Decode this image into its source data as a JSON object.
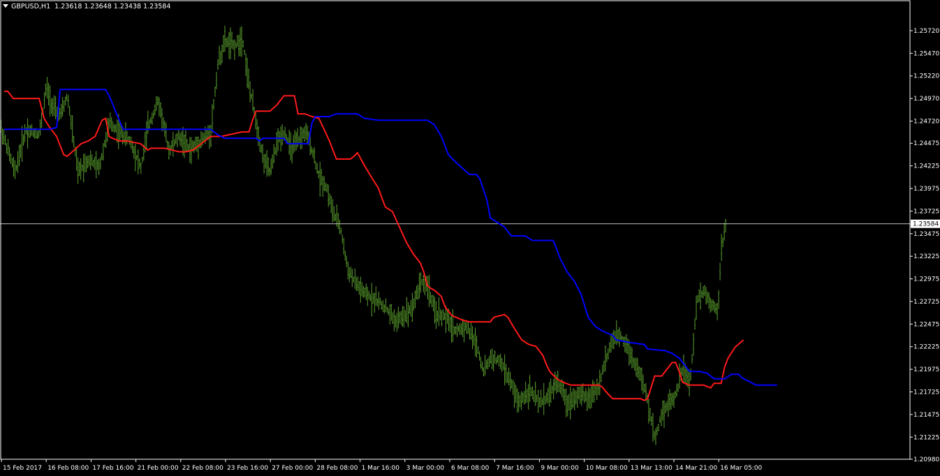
{
  "header": {
    "symbol": "GBPUSD,H1",
    "quote": "1.23618 1.23648 1.23438 1.23584"
  },
  "colors": {
    "background": "#000000",
    "candles": "#5aa02c",
    "line_red": "#ff1a1a",
    "line_blue": "#0000ff",
    "axis": "#ffffff",
    "price_line": "#c0c0c0"
  },
  "chart_data": {
    "type": "line",
    "title": "GBPUSD,H1",
    "ylim": [
      1.2098,
      1.2582
    ],
    "current_price": "1.23584",
    "y_ticks": [
      "1.25720",
      "1.25470",
      "1.25220",
      "1.24970",
      "1.24720",
      "1.24475",
      "1.24225",
      "1.23975",
      "1.23725",
      "1.23475",
      "1.23225",
      "1.22975",
      "1.22725",
      "1.22475",
      "1.22225",
      "1.21975",
      "1.21725",
      "1.21475",
      "1.21225",
      "1.20980"
    ],
    "x_ticks": [
      "15 Feb 2017",
      "16 Feb 08:00",
      "17 Feb 16:00",
      "21 Feb 00:00",
      "22 Feb 08:00",
      "23 Feb 16:00",
      "27 Feb 00:00",
      "28 Feb 08:00",
      "1 Mar 16:00",
      "3 Mar 00:00",
      "6 Mar 08:00",
      "7 Mar 16:00",
      "9 Mar 00:00",
      "10 Mar 08:00",
      "13 Mar 13:00",
      "14 Mar 21:00",
      "16 Mar 05:00"
    ],
    "x_range": [
      0,
      1300
    ],
    "price_series": {
      "name": "",
      "x": [
        0,
        20,
        35,
        55,
        65,
        75,
        85,
        95,
        110,
        125,
        140,
        155,
        170,
        185,
        200,
        210,
        225,
        240,
        255,
        270,
        285,
        300,
        310,
        320,
        335,
        345,
        355,
        365,
        375,
        385,
        395,
        405,
        415,
        425,
        435,
        445,
        455,
        465,
        475,
        485,
        495,
        505,
        520,
        535,
        550,
        565,
        580,
        590,
        600,
        610,
        620,
        635,
        650,
        665,
        680,
        690,
        700,
        715,
        730,
        740,
        755,
        770,
        785,
        795,
        810,
        825,
        840,
        855,
        865,
        875,
        885,
        895,
        905,
        915,
        925,
        935,
        945,
        955,
        965,
        975,
        985,
        995,
        1005,
        1015,
        1025,
        1030,
        1037
      ],
      "y": [
        1.2464,
        1.2415,
        1.2462,
        1.2458,
        1.251,
        1.2485,
        1.2478,
        1.25,
        1.2415,
        1.243,
        1.242,
        1.247,
        1.246,
        1.245,
        1.242,
        1.2465,
        1.2495,
        1.244,
        1.2455,
        1.244,
        1.245,
        1.246,
        1.2535,
        1.256,
        1.2555,
        1.2565,
        1.251,
        1.247,
        1.243,
        1.2415,
        1.245,
        1.246,
        1.244,
        1.245,
        1.246,
        1.244,
        1.241,
        1.24,
        1.237,
        1.2355,
        1.231,
        1.2295,
        1.228,
        1.2275,
        1.2265,
        1.225,
        1.226,
        1.227,
        1.2295,
        1.229,
        1.226,
        1.2255,
        1.224,
        1.2245,
        1.2225,
        1.2195,
        1.221,
        1.2205,
        1.218,
        1.216,
        1.2175,
        1.216,
        1.217,
        1.2185,
        1.216,
        1.217,
        1.2165,
        1.218,
        1.221,
        1.223,
        1.2235,
        1.2225,
        1.2205,
        1.219,
        1.216,
        1.212,
        1.215,
        1.216,
        1.217,
        1.22,
        1.218,
        1.2275,
        1.2285,
        1.227,
        1.2265,
        1.233,
        1.236
      ]
    },
    "series": [
      {
        "name": "",
        "color": "#ff1a1a",
        "x": [
          5,
          10,
          18,
          55,
          62,
          70,
          80,
          90,
          95,
          105,
          115,
          125,
          135,
          145,
          150,
          155,
          160,
          170,
          180,
          200,
          210,
          215,
          225,
          235,
          255,
          265,
          275,
          300,
          315,
          345,
          355,
          360,
          365,
          375,
          385,
          395,
          405,
          410,
          420,
          425,
          435,
          445,
          455,
          470,
          480,
          500,
          505,
          510,
          520,
          530,
          540,
          545,
          550,
          560,
          570,
          580,
          590,
          600,
          605,
          610,
          615,
          620,
          630,
          635,
          645,
          660,
          670,
          680,
          690,
          700,
          705,
          720,
          725,
          735,
          745,
          755,
          765,
          775,
          780,
          785,
          795,
          805,
          815,
          825,
          840,
          850,
          855,
          860,
          865,
          875,
          885,
          905,
          915,
          920,
          925,
          935,
          945,
          955,
          960,
          965,
          970,
          975,
          985,
          1005,
          1015,
          1020,
          1030,
          1035,
          1040,
          1050,
          1062
        ],
        "y": [
          1.2505,
          1.2505,
          1.2497,
          1.2497,
          1.2475,
          1.2465,
          1.2455,
          1.2435,
          1.2433,
          1.244,
          1.2447,
          1.245,
          1.2455,
          1.2473,
          1.2475,
          1.2455,
          1.2453,
          1.245,
          1.245,
          1.2447,
          1.244,
          1.2442,
          1.2442,
          1.2442,
          1.2438,
          1.2438,
          1.244,
          1.2455,
          1.2455,
          1.246,
          1.246,
          1.2473,
          1.2483,
          1.2483,
          1.2483,
          1.249,
          1.25,
          1.25,
          1.25,
          1.248,
          1.248,
          1.2477,
          1.2475,
          1.245,
          1.243,
          1.243,
          1.2433,
          1.2437,
          1.2423,
          1.241,
          1.2398,
          1.2387,
          1.2377,
          1.2372,
          1.2355,
          1.2338,
          1.2325,
          1.2315,
          1.2305,
          1.229,
          1.2287,
          1.2285,
          1.2278,
          1.2267,
          1.2257,
          1.2252,
          1.225,
          1.225,
          1.225,
          1.225,
          1.2255,
          1.2258,
          1.2255,
          1.2242,
          1.223,
          1.2225,
          1.2223,
          1.2213,
          1.2203,
          1.2195,
          1.2187,
          1.2183,
          1.218,
          1.218,
          1.218,
          1.218,
          1.218,
          1.2178,
          1.2173,
          1.2165,
          1.2165,
          1.2165,
          1.2165,
          1.2163,
          1.2165,
          1.219,
          1.219,
          1.22,
          1.2205,
          1.2205,
          1.2195,
          1.2183,
          1.218,
          1.218,
          1.2177,
          1.2182,
          1.2182,
          1.22,
          1.221,
          1.2222,
          1.223
        ]
      },
      {
        "name": "",
        "color": "#0000ff",
        "x": [
          5,
          70,
          80,
          85,
          150,
          155,
          175,
          190,
          200,
          300,
          310,
          320,
          350,
          365,
          370,
          375,
          405,
          410,
          440,
          445,
          450,
          470,
          480,
          510,
          520,
          540,
          610,
          620,
          630,
          640,
          650,
          660,
          670,
          680,
          685,
          695,
          700,
          710,
          720,
          730,
          750,
          760,
          790,
          800,
          810,
          820,
          830,
          840,
          850,
          860,
          875,
          880,
          900,
          920,
          925,
          950,
          960,
          970,
          975,
          985,
          1000,
          1010,
          1015,
          1020,
          1025,
          1035,
          1045,
          1055,
          1060,
          1080,
          1110
        ],
        "y": [
          1.2463,
          1.2463,
          1.2465,
          1.2507,
          1.2507,
          1.25,
          1.2463,
          1.2463,
          1.2463,
          1.2463,
          1.2457,
          1.2453,
          1.2453,
          1.2453,
          1.245,
          1.2453,
          1.2453,
          1.2447,
          1.2447,
          1.247,
          1.2477,
          1.2477,
          1.248,
          1.248,
          1.2475,
          1.2473,
          1.2473,
          1.2468,
          1.2455,
          1.2435,
          1.2427,
          1.242,
          1.2413,
          1.2413,
          1.2408,
          1.2385,
          1.2365,
          1.236,
          1.2355,
          1.2345,
          1.2345,
          1.234,
          1.234,
          1.232,
          1.2305,
          1.2295,
          1.228,
          1.2255,
          1.2245,
          1.224,
          1.2235,
          1.223,
          1.2227,
          1.2225,
          1.222,
          1.2218,
          1.2215,
          1.221,
          1.2205,
          1.2195,
          1.2195,
          1.2193,
          1.219,
          1.2187,
          1.2187,
          1.2187,
          1.2192,
          1.2192,
          1.2188,
          1.218,
          1.218
        ]
      }
    ]
  }
}
